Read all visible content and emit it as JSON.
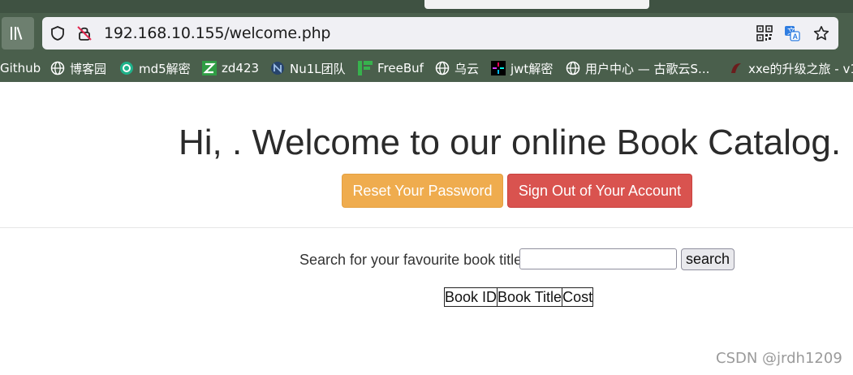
{
  "browser": {
    "url": "192.168.10.155/welcome.php",
    "colors": {
      "chrome": "#4a5f4c",
      "urlbar": "#f0f0f4"
    },
    "bookmarks": [
      {
        "label": "Github",
        "icon": "none"
      },
      {
        "label": "博客园",
        "icon": "globe-icon"
      },
      {
        "label": "md5解密",
        "icon": "md5-logo-icon"
      },
      {
        "label": "zd423",
        "icon": "z-logo-icon"
      },
      {
        "label": "Nu1L团队",
        "icon": "nu1l-logo-icon"
      },
      {
        "label": "FreeBuf",
        "icon": "freebuf-logo-icon"
      },
      {
        "label": "乌云",
        "icon": "globe-icon"
      },
      {
        "label": "jwt解密",
        "icon": "jwt-logo-icon"
      },
      {
        "label": "用户中心 — 古歌云S...",
        "icon": "globe-icon"
      },
      {
        "label": "xxe的升级之旅 - v1",
        "icon": "xxe-logo-icon"
      }
    ]
  },
  "page": {
    "welcome": "Hi, . Welcome to our online Book Catalog.",
    "reset_label": "Reset Your Password",
    "signout_label": "Sign Out of Your Account",
    "search_label": "Search for your favourite book title",
    "search_value": "",
    "search_button": "search",
    "table_headers": [
      "Book ID",
      "Book Title",
      "Cost"
    ],
    "colors": {
      "reset": "#efac4e",
      "signout": "#d9534f"
    }
  },
  "watermark": "CSDN @jrdh1209"
}
